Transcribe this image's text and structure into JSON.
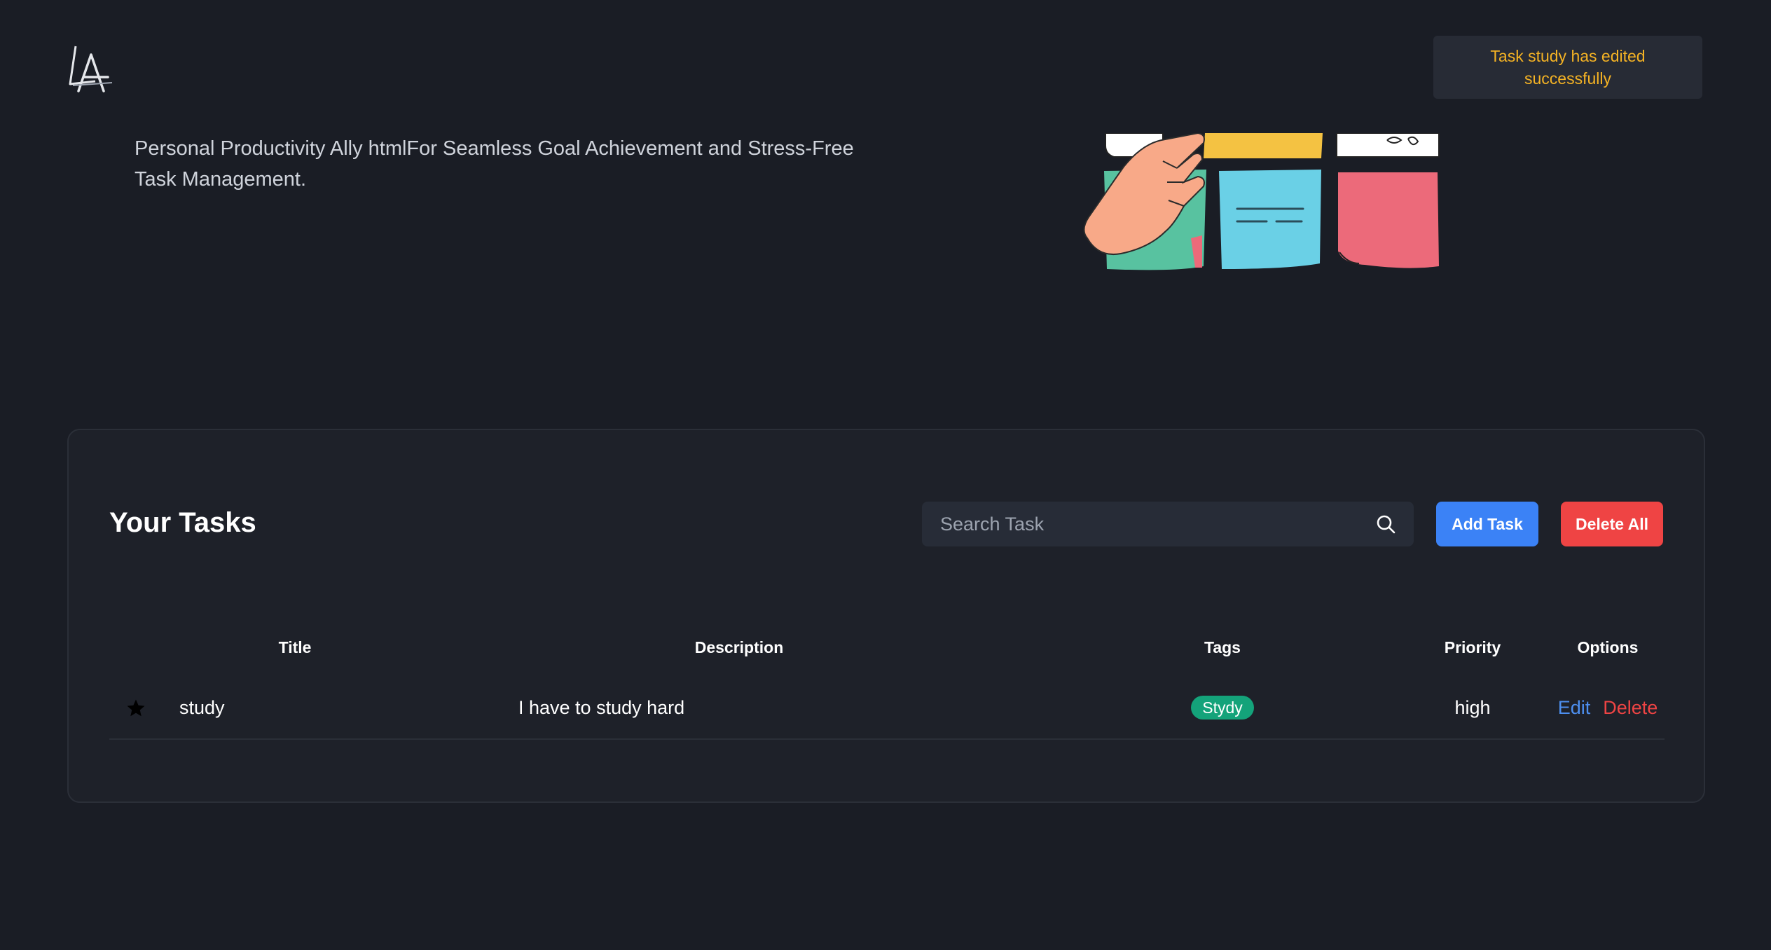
{
  "header": {
    "logo_icon": "letter-a-logo-icon"
  },
  "toast": {
    "message": "Task study has edited successfully",
    "color": "#f5b324"
  },
  "hero": {
    "tagline": "Personal Productivity Ally htmlFor Seamless Goal Achievement and Stress-Free Task Management.",
    "illustration_icon": "sticky-notes-hand-illustration"
  },
  "tasks": {
    "title": "Your Tasks",
    "search": {
      "placeholder": "Search Task",
      "value": "",
      "icon": "search-icon"
    },
    "add_button": {
      "label": "Add Task",
      "color": "#3b82f6"
    },
    "delete_all_button": {
      "label": "Delete All",
      "color": "#ef4444"
    },
    "columns": {
      "star": "",
      "title": "Title",
      "description": "Description",
      "tags": "Tags",
      "priority": "Priority",
      "options": "Options"
    },
    "rows": [
      {
        "starred": true,
        "title": "study",
        "description": "I have to study hard",
        "tag": "Stydy",
        "tag_color": "#14a37a",
        "priority": "high",
        "edit_label": "Edit",
        "delete_label": "Delete"
      }
    ]
  }
}
